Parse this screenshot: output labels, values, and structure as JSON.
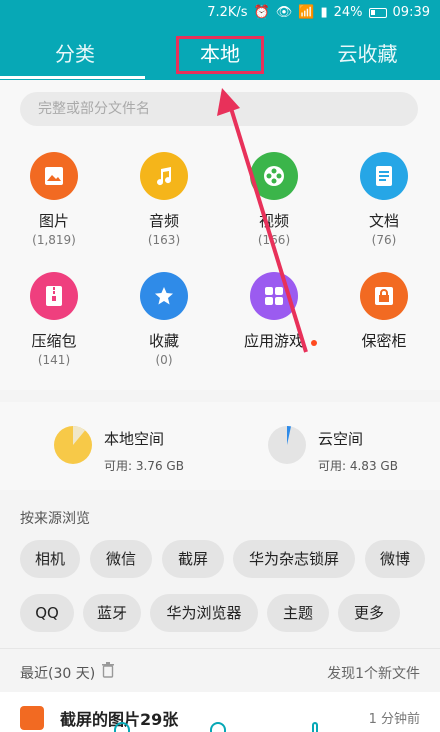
{
  "status_bar": {
    "speed": "7.2K/s",
    "battery": "24%",
    "time": "09:39",
    "icons": [
      "alarm-icon",
      "eye-icon",
      "wifi-icon",
      "signal-icon",
      "battery-icon"
    ]
  },
  "tabs": [
    {
      "label": "分类",
      "active": true
    },
    {
      "label": "本地",
      "active": false
    },
    {
      "label": "云收藏",
      "active": false
    }
  ],
  "search": {
    "placeholder": "完整或部分文件名"
  },
  "categories": [
    {
      "label": "图片",
      "count": "(1,819)",
      "color": "#f26a22",
      "icon": "image-icon"
    },
    {
      "label": "音频",
      "count": "(163)",
      "color": "#f5b51a",
      "icon": "music-icon"
    },
    {
      "label": "视频",
      "count": "(166)",
      "color": "#3bb54a",
      "icon": "film-icon"
    },
    {
      "label": "文档",
      "count": "(76)",
      "color": "#26a6e6",
      "icon": "document-icon"
    },
    {
      "label": "压缩包",
      "count": "(141)",
      "color": "#ef3f7e",
      "icon": "zip-icon"
    },
    {
      "label": "收藏",
      "count": "(0)",
      "color": "#2f8be8",
      "icon": "star-icon"
    },
    {
      "label": "应用游戏",
      "count": "",
      "color": "#9b5bf0",
      "icon": "apps-icon"
    },
    {
      "label": "保密柜",
      "count": "",
      "color": "#f26a22",
      "icon": "safe-icon"
    }
  ],
  "storage": {
    "local": {
      "label": "本地空间",
      "available": "可用: 3.76 GB",
      "used_fraction": 0.72,
      "color": "#f7c948"
    },
    "cloud": {
      "label": "云空间",
      "available": "可用: 4.83 GB",
      "used_fraction": 0.03,
      "color": "#2f8be8"
    }
  },
  "browse": {
    "title": "按来源浏览",
    "sources": [
      "相机",
      "微信",
      "截屏",
      "华为杂志锁屏",
      "微博",
      "QQ",
      "蓝牙",
      "华为浏览器",
      "主题",
      "更多"
    ]
  },
  "recent": {
    "title": "最近(30 天)",
    "discover": "发现1个新文件",
    "item_title": "截屏的图片29张",
    "item_time": "1 分钟前"
  }
}
